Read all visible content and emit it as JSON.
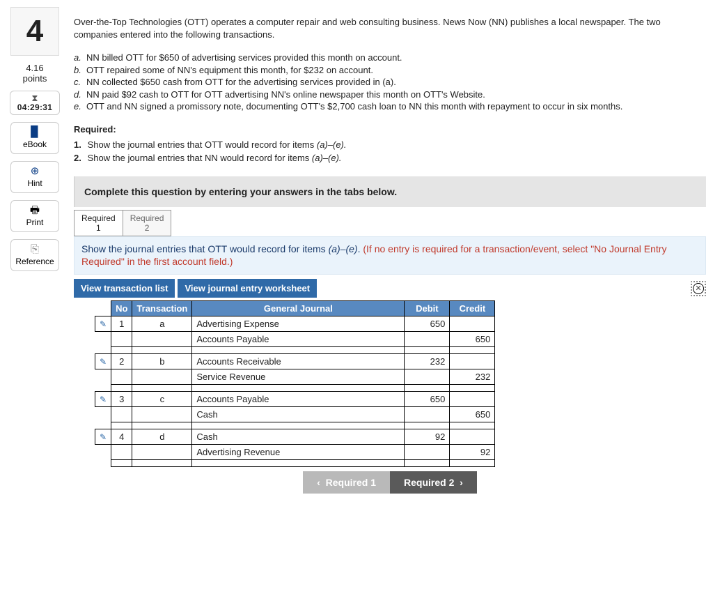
{
  "question": {
    "number": "4",
    "points_value": "4.16",
    "points_label": "points",
    "timer": "04:29:31"
  },
  "tools": {
    "ebook": "eBook",
    "hint": "Hint",
    "print": "Print",
    "reference": "Reference"
  },
  "intro": "Over-the-Top Technologies (OTT) operates a computer repair and web consulting business. News Now (NN) publishes a local newspaper. The two companies entered into the following transactions.",
  "transactions": {
    "a": "NN billed OTT for $650 of advertising services provided this month on account.",
    "b": "OTT repaired some of NN's equipment this month, for $232 on account.",
    "c": "NN collected $650 cash from OTT for the advertising services provided in (a).",
    "d": "NN paid $92 cash to OTT for OTT advertising NN's online newspaper this month on OTT's Website.",
    "e": "OTT and NN signed a promissory note, documenting OTT's $2,700 cash loan to NN this month with repayment to occur in six months."
  },
  "required": {
    "heading": "Required:",
    "item1_pre": "Show the journal entries that OTT would record for items ",
    "item1_ital": "(a)–(e).",
    "item2_pre": "Show the journal entries that NN would record for items ",
    "item2_ital": "(a)–(e)."
  },
  "instruction_bar": "Complete this question by entering your answers in the tabs below.",
  "tabs": {
    "t1_line1": "Required",
    "t1_line2": "1",
    "t2_line1": "Required",
    "t2_line2": "2"
  },
  "prompt": {
    "pre": "Show the journal entries that OTT would record for items ",
    "ital": "(a)–(e)",
    "post": ". ",
    "red": "(If no entry is required for a transaction/event, select \"No Journal Entry Required\" in the first account field.)"
  },
  "view_buttons": {
    "list": "View transaction list",
    "worksheet": "View journal entry worksheet"
  },
  "journal": {
    "headers": {
      "no": "No",
      "transaction": "Transaction",
      "general": "General Journal",
      "debit": "Debit",
      "credit": "Credit"
    },
    "rows": [
      {
        "no": "1",
        "tr": "a",
        "line1": "Advertising Expense",
        "d1": "650",
        "c1": "",
        "line2": "Accounts Payable",
        "d2": "",
        "c2": "650"
      },
      {
        "no": "2",
        "tr": "b",
        "line1": "Accounts Receivable",
        "d1": "232",
        "c1": "",
        "line2": "Service Revenue",
        "d2": "",
        "c2": "232"
      },
      {
        "no": "3",
        "tr": "c",
        "line1": "Accounts Payable",
        "d1": "650",
        "c1": "",
        "line2": "Cash",
        "d2": "",
        "c2": "650"
      },
      {
        "no": "4",
        "tr": "d",
        "line1": "Cash",
        "d1": "92",
        "c1": "",
        "line2": "Advertising Revenue",
        "d2": "",
        "c2": "92"
      }
    ]
  },
  "nav": {
    "prev": "Required 1",
    "next": "Required 2"
  },
  "icons": {
    "hourglass": "⧗",
    "book": "▉",
    "hint": "⊕",
    "print": "🖶",
    "copy": "⎘",
    "pencil": "✎",
    "close": "✕",
    "chev_left": "‹",
    "chev_right": "›"
  }
}
